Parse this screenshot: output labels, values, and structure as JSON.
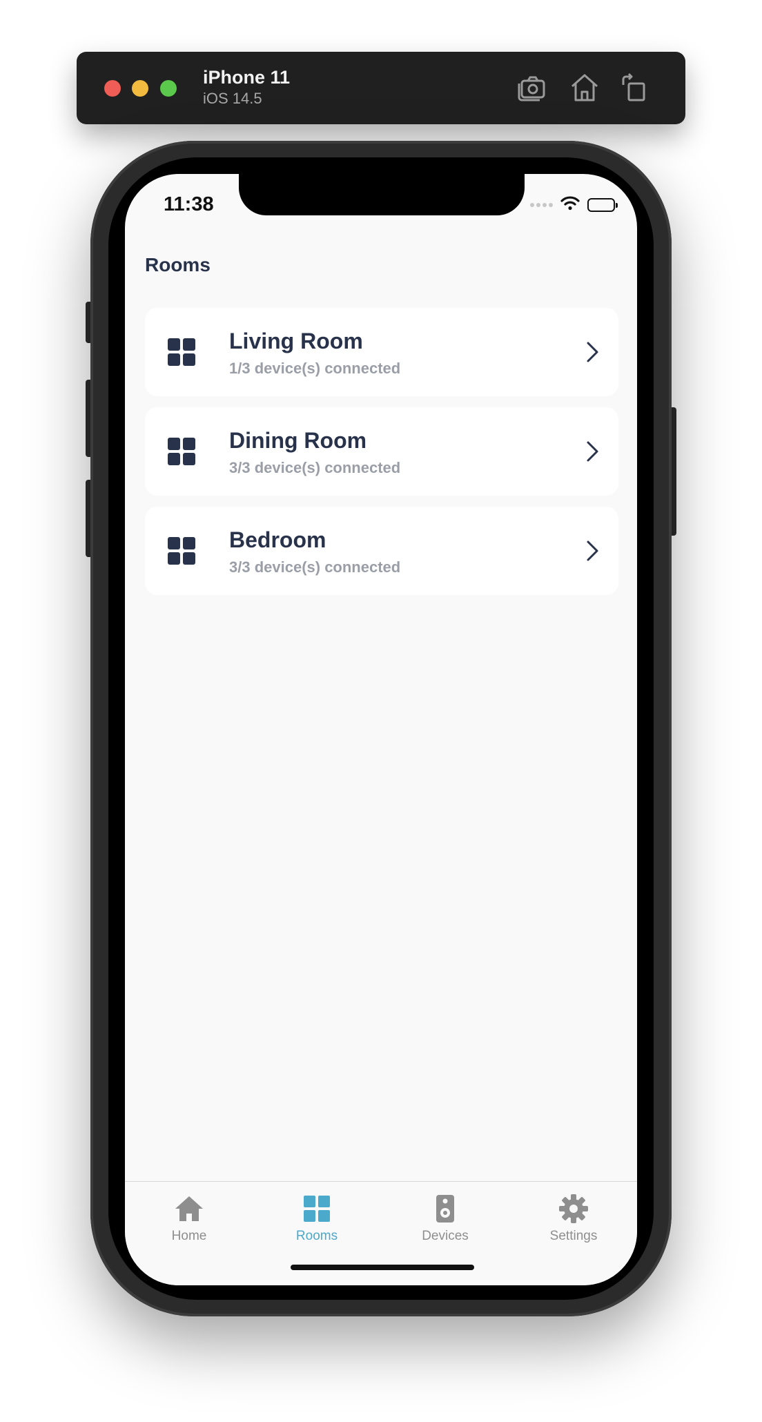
{
  "simulator": {
    "device_name": "iPhone 11",
    "os_version": "iOS 14.5",
    "icons": [
      "screenshot-icon",
      "home-icon",
      "rotate-icon"
    ]
  },
  "status_bar": {
    "time": "11:38",
    "icons": [
      "cellular-icon",
      "wifi-icon",
      "battery-icon"
    ]
  },
  "page": {
    "title": "Rooms"
  },
  "rooms": [
    {
      "name": "Living Room",
      "status": "1/3 device(s) connected",
      "icon": "grid-icon"
    },
    {
      "name": "Dining Room",
      "status": "3/3 device(s) connected",
      "icon": "grid-icon"
    },
    {
      "name": "Bedroom",
      "status": "3/3 device(s) connected",
      "icon": "grid-icon"
    }
  ],
  "tab_bar": {
    "tabs": [
      {
        "label": "Home",
        "icon": "house-icon",
        "active": false
      },
      {
        "label": "Rooms",
        "icon": "grid-icon",
        "active": true
      },
      {
        "label": "Devices",
        "icon": "speaker-icon",
        "active": false
      },
      {
        "label": "Settings",
        "icon": "gear-icon",
        "active": false
      }
    ]
  },
  "colors": {
    "accent": "#4ba9cc",
    "text_primary": "#28324a",
    "text_secondary": "#9a9ea6",
    "tab_inactive": "#8e8e8e",
    "screen_background": "#f9f9f9"
  }
}
